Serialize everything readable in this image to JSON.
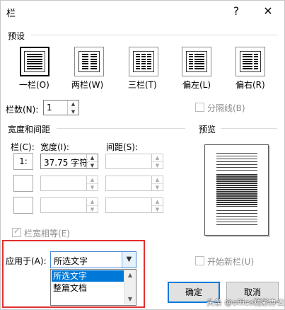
{
  "window": {
    "title": "栏",
    "help_glyph": "?",
    "close_glyph": "✕"
  },
  "presets": {
    "label": "预设",
    "items": [
      {
        "label": "一栏(O)",
        "columns": 1,
        "selected": true
      },
      {
        "label": "两栏(W)",
        "columns": 2,
        "selected": false
      },
      {
        "label": "三栏(T)",
        "columns": 3,
        "selected": false
      },
      {
        "label": "偏左(L)",
        "columns": "left",
        "selected": false
      },
      {
        "label": "偏右(R)",
        "columns": "right",
        "selected": false
      }
    ]
  },
  "columns_count": {
    "label": "栏数(N):",
    "value": "1"
  },
  "separator": {
    "label": "分隔线(B)",
    "checked": false
  },
  "width_spacing": {
    "label": "宽度和间距",
    "col_header": "栏(C):",
    "width_header": "宽度(I):",
    "spacing_header": "间距(S):",
    "rows": [
      {
        "num": "1:",
        "width": "37.75 字符",
        "spacing": ""
      },
      {
        "num": "",
        "width": "",
        "spacing": ""
      },
      {
        "num": "",
        "width": "",
        "spacing": ""
      }
    ]
  },
  "equal_width": {
    "label": "栏宽相等(E)",
    "checked": true
  },
  "preview": {
    "label": "预览"
  },
  "apply_to": {
    "label": "应用于(A):",
    "value": "所选文字",
    "options": [
      "所选文字",
      "整篇文档"
    ]
  },
  "new_column": {
    "label": "开始新栏(U)",
    "checked": false
  },
  "buttons": {
    "ok": "确定",
    "cancel": "取消"
  },
  "watermark": "头条 @office精彩办公"
}
